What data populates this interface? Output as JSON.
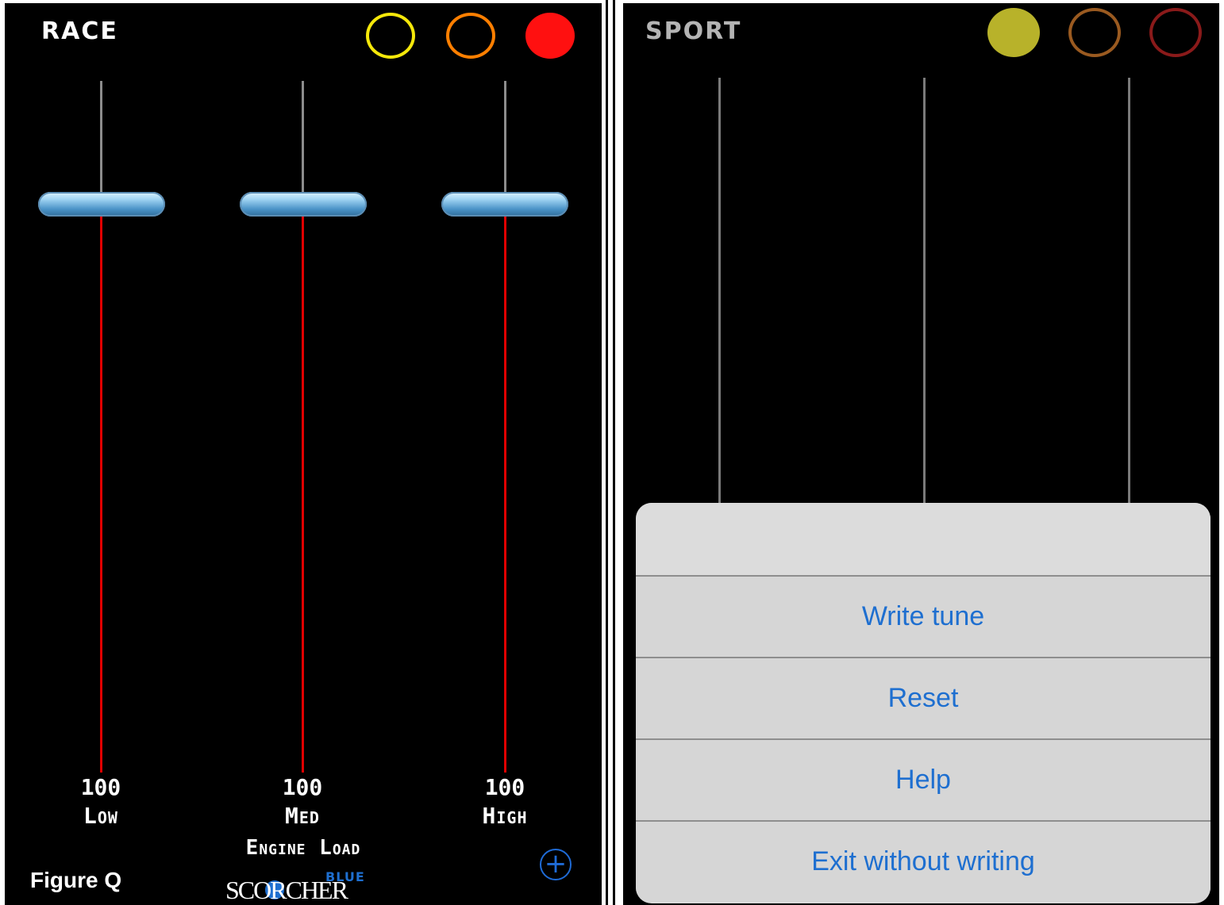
{
  "left": {
    "mode_title": "RACE",
    "mode_dots": [
      {
        "name": "yellow-mode-dot",
        "color": "#f5e80a",
        "filled": false
      },
      {
        "name": "orange-mode-dot",
        "color": "#ff7f00",
        "filled": false
      },
      {
        "name": "red-mode-dot",
        "color": "#ff1010",
        "filled": true
      }
    ],
    "sliders": [
      {
        "value": "100",
        "label": "Low",
        "level": 1.0
      },
      {
        "value": "100",
        "label": "Med",
        "level": 1.0
      },
      {
        "value": "100",
        "label": "High",
        "level": 1.0
      }
    ],
    "footer_label": "Engine Load",
    "add_icon": "plus-circle-icon",
    "logo": {
      "blue": "BLUE",
      "main": "SCORCHER"
    },
    "figure_caption": "Figure Q"
  },
  "right": {
    "mode_title": "SPORT",
    "mode_dots": [
      {
        "name": "yellow-mode-dot",
        "color": "#b8b22a",
        "filled": true
      },
      {
        "name": "orange-mode-dot",
        "color": "#9a5a20",
        "filled": false
      },
      {
        "name": "red-mode-dot",
        "color": "#8a1a1a",
        "filled": false
      }
    ],
    "action_sheet": {
      "items": [
        "Write tune",
        "Reset",
        "Help",
        "Exit without writing"
      ]
    }
  },
  "colors": {
    "accent_blue": "#1e6fd0",
    "track_red": "#e00000"
  }
}
